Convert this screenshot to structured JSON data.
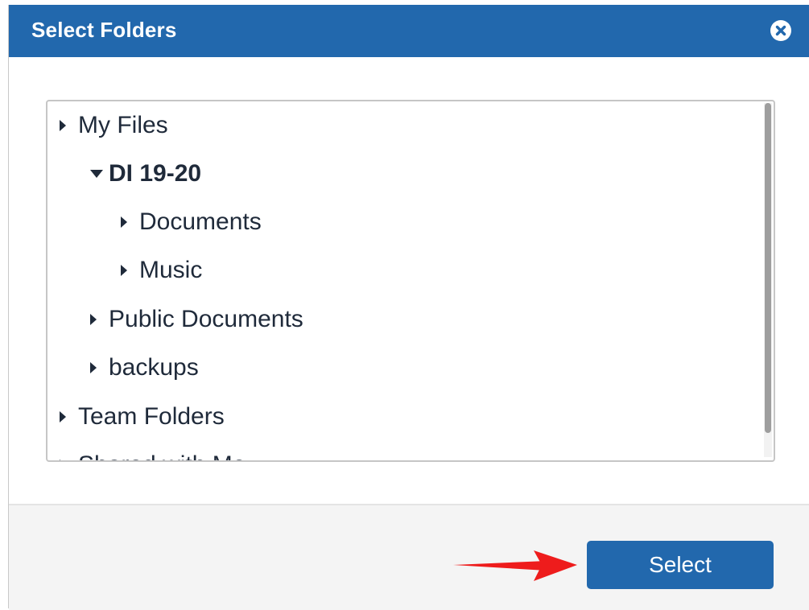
{
  "dialog": {
    "title": "Select Folders",
    "close_icon": "close-icon",
    "header_color": "#2268ad"
  },
  "tree": {
    "items": [
      {
        "label": "My Files",
        "expanded": false
      },
      {
        "label": "DI 19-20",
        "expanded": true,
        "selected": true
      },
      {
        "label": "Documents",
        "expanded": false
      },
      {
        "label": "Music",
        "expanded": false
      },
      {
        "label": "Public Documents",
        "expanded": false
      },
      {
        "label": "backups",
        "expanded": false
      },
      {
        "label": "Team Folders",
        "expanded": false
      },
      {
        "label": "Shared with Me",
        "expanded": false
      }
    ]
  },
  "footer": {
    "select_label": "Select",
    "button_color": "#2268ad",
    "annotation": "red-arrow-pointing-right"
  }
}
